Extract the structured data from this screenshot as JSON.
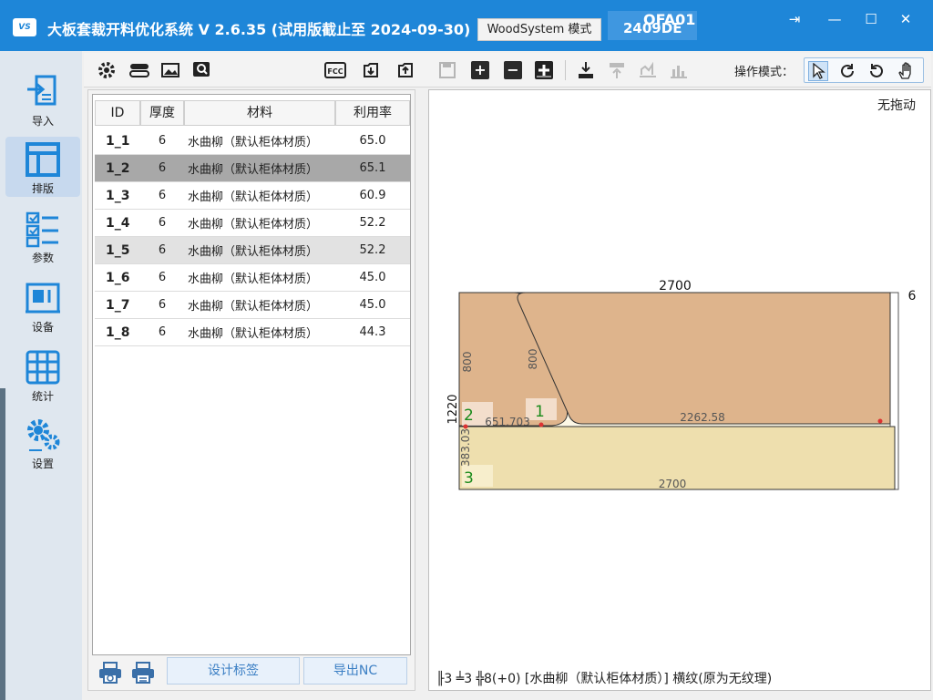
{
  "titlebar": {
    "logo": "VS",
    "title": "大板套裁开料优化系统  V 2.6.35  (试用版截止至 2024-09-30)",
    "mode": "WoodSystem 模式",
    "device_code1": "OFA01",
    "device_code2": "2409DE",
    "controls": [
      "⇥",
      "—",
      "☐",
      "✕"
    ]
  },
  "nav": [
    {
      "label": "导入",
      "icon": "import-icon"
    },
    {
      "label": "排版",
      "icon": "layout-icon",
      "active": true
    },
    {
      "label": "参数",
      "icon": "checklist-icon"
    },
    {
      "label": "设备",
      "icon": "machine-icon"
    },
    {
      "label": "统计",
      "icon": "table-icon"
    },
    {
      "label": "设置",
      "icon": "gears-icon"
    }
  ],
  "toolbar": {
    "operation_mode_label": "操作模式："
  },
  "table": {
    "headers": [
      "ID",
      "厚度",
      "材料",
      "利用率"
    ],
    "rows": [
      {
        "id": "1_1",
        "thickness": "6",
        "material": "水曲柳（默认柜体材质）",
        "rate": "65.0"
      },
      {
        "id": "1_2",
        "thickness": "6",
        "material": "水曲柳（默认柜体材质）",
        "rate": "65.1"
      },
      {
        "id": "1_3",
        "thickness": "6",
        "material": "水曲柳（默认柜体材质）",
        "rate": "60.9"
      },
      {
        "id": "1_4",
        "thickness": "6",
        "material": "水曲柳（默认柜体材质）",
        "rate": "52.2"
      },
      {
        "id": "1_5",
        "thickness": "6",
        "material": "水曲柳（默认柜体材质）",
        "rate": "52.2"
      },
      {
        "id": "1_6",
        "thickness": "6",
        "material": "水曲柳（默认柜体材质）",
        "rate": "45.0"
      },
      {
        "id": "1_7",
        "thickness": "6",
        "material": "水曲柳（默认柜体材质）",
        "rate": "45.0"
      },
      {
        "id": "1_8",
        "thickness": "6",
        "material": "水曲柳（默认柜体材质）",
        "rate": "44.3"
      }
    ]
  },
  "buttons": {
    "design_label": "设计标签",
    "export_nc": "导出NC"
  },
  "canvas": {
    "no_drag": "无拖动",
    "sheet": {
      "width_label": "2700",
      "height_label": "1220",
      "thickness_label": "6",
      "part1_num": "1",
      "part2_num": "2",
      "part3_num": "3",
      "part1_w": "2262.58",
      "part1_h": "800",
      "part2_w": "651.703",
      "part2_h": "800",
      "part3_w": "2700",
      "part3_h": "383.03"
    },
    "status": "╟3 ╧3  ╬8(+0)   [水曲柳（默认柜体材质）] 横纹(原为无纹理)"
  },
  "colors": {
    "titlebar": "#1e86d8",
    "part_brown": "#deb48c",
    "part_tan": "#eedfae",
    "text_green": "#1a8a1a"
  }
}
